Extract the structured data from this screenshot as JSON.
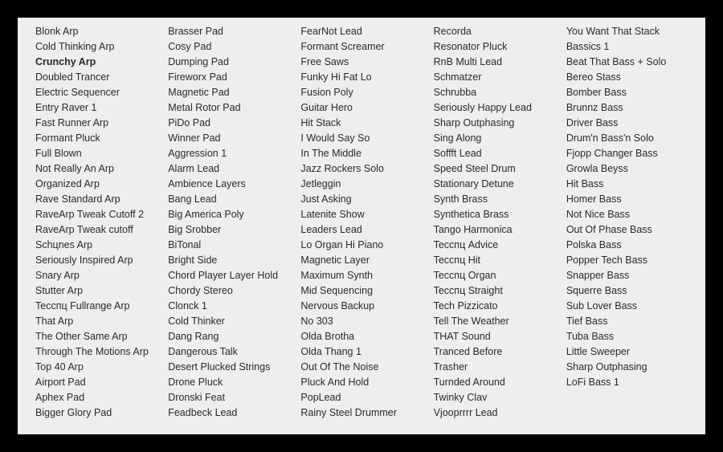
{
  "selected": "Crunchy Arp",
  "columns": [
    [
      "Blonk Arp",
      "Cold Thinking Arp",
      "Crunchy Arp",
      "Doubled Trancer",
      "Electric Sequencer",
      "Entry Raver 1",
      "Fast Runner Arp",
      "Formant Pluck",
      "Full Blown",
      "Not Really An Arp",
      "Organized Arp",
      "Rave Standard Arp",
      "RaveArp Tweak Cutoff 2",
      "RaveArp Tweak cutoff",
      "Schцnes Arp",
      "Seriously Inspired Arp",
      "Snary Arp",
      "Stutter Arp",
      "Tecспц Fullrange Arp",
      "That Arp",
      "The Other Same Arp",
      "Through The Motions Arp",
      "Top 40 Arp",
      "Airport Pad",
      "Aphex Pad",
      "Bigger Glory Pad"
    ],
    [
      "Brasser Pad",
      "Cosy Pad",
      "Dumping Pad",
      "Fireworx Pad",
      "Magnetic Pad",
      "Metal Rotor Pad",
      "PiDo Pad",
      "Winner Pad",
      "Aggression 1",
      "Alarm Lead",
      "Ambience Layers",
      "Bang Lead",
      "Big America Poly",
      "Big Srobber",
      "BiTonal",
      "Bright Side",
      "Chord Player Layer Hold",
      "Chordy Stereo",
      "Clonck 1",
      "Cold Thinker",
      "Dang Rang",
      "Dangerous Talk",
      "Desert Plucked Strings",
      "Drone Pluck",
      "Dronski Feat",
      "Feadbeck Lead"
    ],
    [
      "FearNot Lead",
      "Formant Screamer",
      "Free Saws",
      "Funky Hi Fat Lo",
      "Fusion Poly",
      "Guitar Hero",
      "Hit Stack",
      "I Would Say So",
      "In The Middle",
      "Jazz Rockers Solo",
      "Jetleggin",
      "Just Asking",
      "Latenite Show",
      "Leaders Lead",
      "Lo Organ Hi Piano",
      "Magnetic Layer",
      "Maximum Synth",
      "Mid Sequencing",
      "Nervous Backup",
      "No 303",
      "Olda Brotha",
      "Olda Thang 1",
      "Out Of The Noise",
      "Pluck And Hold",
      "PopLead",
      "Rainy Steel Drummer"
    ],
    [
      "Recorda",
      "Resonator Pluck",
      "RnB Multi Lead",
      "Schmatzer",
      "Schrubba",
      "Seriously Happy Lead",
      "Sharp Outphasing",
      "Sing Along",
      "Soffft Lead",
      "Speed Steel Drum",
      "Stationary Detune",
      "Synth Brass",
      "Synthetica Brass",
      "Tango Harmonica",
      "Tecспц Advice",
      "Tecспц Hit",
      "Tecспц Organ",
      "Tecспц Straight",
      "Tech Pizzicato",
      "Tell The Weather",
      "THAT Sound",
      "Tranced Before",
      "Trasher",
      "Turnded Around",
      "Twinky Clav",
      "Vjooprrrr Lead"
    ],
    [
      "You Want That Stack",
      "Bassics 1",
      "Beat That Bass + Solo",
      "Bereo Stass",
      "Bomber Bass",
      "Brunnz Bass",
      "Driver Bass",
      "Drum'n Bass'n Solo",
      "Fjopp Changer Bass",
      "Growla Beyss",
      "Hit Bass",
      "Homer Bass",
      "Not Nice Bass",
      "Out Of Phase Bass",
      "Polska Bass",
      "Popper Tech Bass",
      "Snapper Bass",
      "Squerre Bass",
      "Sub Lover Bass",
      "Tief Bass",
      "Tuba Bass",
      "Little Sweeper",
      "Sharp Outphasing",
      "LoFi Bass 1"
    ]
  ]
}
